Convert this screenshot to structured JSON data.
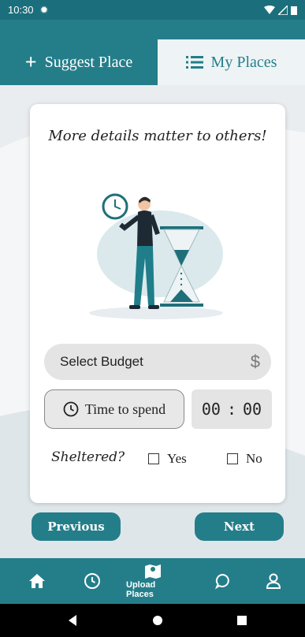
{
  "status": {
    "time": "10:30"
  },
  "tabs": {
    "suggest_label": "Suggest Place",
    "my_label": "My Places"
  },
  "card": {
    "title": "More details matter to others!",
    "budget_placeholder": "Select Budget",
    "budget_symbol": "$",
    "time_label": "Time to spend",
    "time_hours": "00",
    "time_sep": ":",
    "time_minutes": "00",
    "sheltered_label": "Sheltered?",
    "yes_label": "Yes",
    "no_label": "No"
  },
  "buttons": {
    "previous": "Previous",
    "next": "Next"
  },
  "bottom_nav": {
    "upload_label": "Upload Places"
  },
  "colors": {
    "primary": "#247e8a",
    "status": "#1b6f7c",
    "tab_inactive": "#eef4f5"
  }
}
